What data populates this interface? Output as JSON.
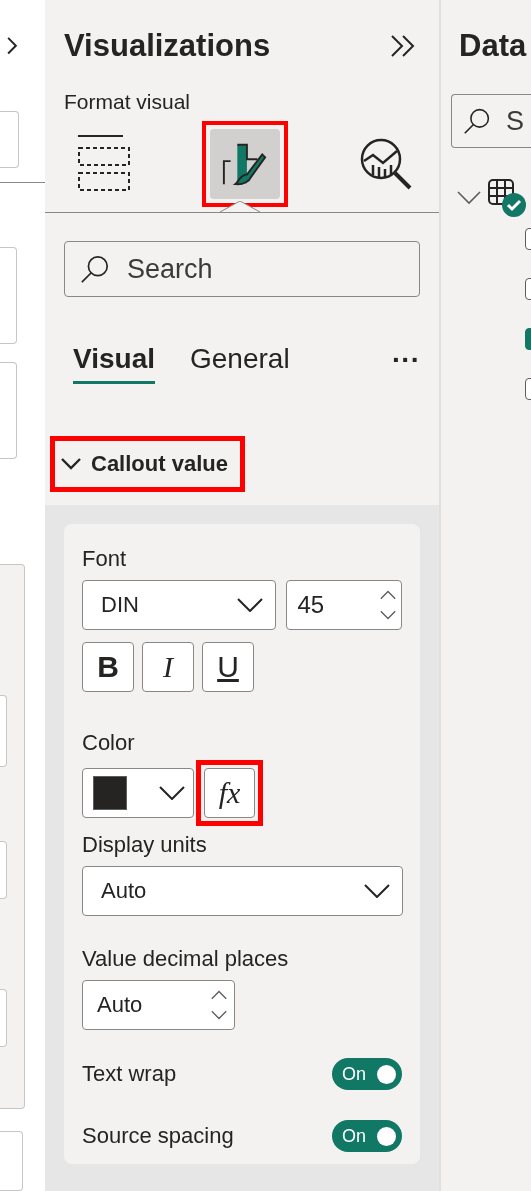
{
  "pane": {
    "title": "Visualizations",
    "subtitle": "Format visual",
    "view_tabs": [
      {
        "kind": "fields",
        "selected": false,
        "highlighted": false
      },
      {
        "kind": "format",
        "selected": true,
        "highlighted": true
      },
      {
        "kind": "analytics",
        "selected": false,
        "highlighted": false
      }
    ],
    "search": {
      "placeholder": "Search"
    },
    "tabs": [
      {
        "label": "Visual",
        "selected": true
      },
      {
        "label": "General",
        "selected": false
      }
    ],
    "more_label": "···",
    "section": {
      "title": "Callout value",
      "expanded": true,
      "highlighted": true
    },
    "font": {
      "label": "Font",
      "family": "DIN",
      "size": "45",
      "styles": [
        {
          "label": "B",
          "kind": "bold"
        },
        {
          "label": "I",
          "kind": "italic"
        },
        {
          "label": "U",
          "kind": "underline"
        }
      ]
    },
    "color": {
      "label": "Color",
      "swatch": {
        "color": "#252423"
      },
      "fx_label": "fx",
      "fx_highlighted": true
    },
    "display_units": {
      "label": "Display units",
      "value": "Auto"
    },
    "decimal_places": {
      "label": "Value decimal places",
      "value": "Auto"
    },
    "toggles": [
      {
        "label": "Text wrap",
        "on": true,
        "state_label": "On"
      },
      {
        "label": "Source spacing",
        "on": true,
        "state_label": "On"
      }
    ]
  },
  "data_pane": {
    "title": "Data",
    "search": {
      "placeholder": "S"
    },
    "table": {
      "expanded": true,
      "fields": [
        {
          "checked": false
        },
        {
          "checked": false
        },
        {
          "checked": true
        },
        {
          "checked": false
        }
      ]
    }
  }
}
